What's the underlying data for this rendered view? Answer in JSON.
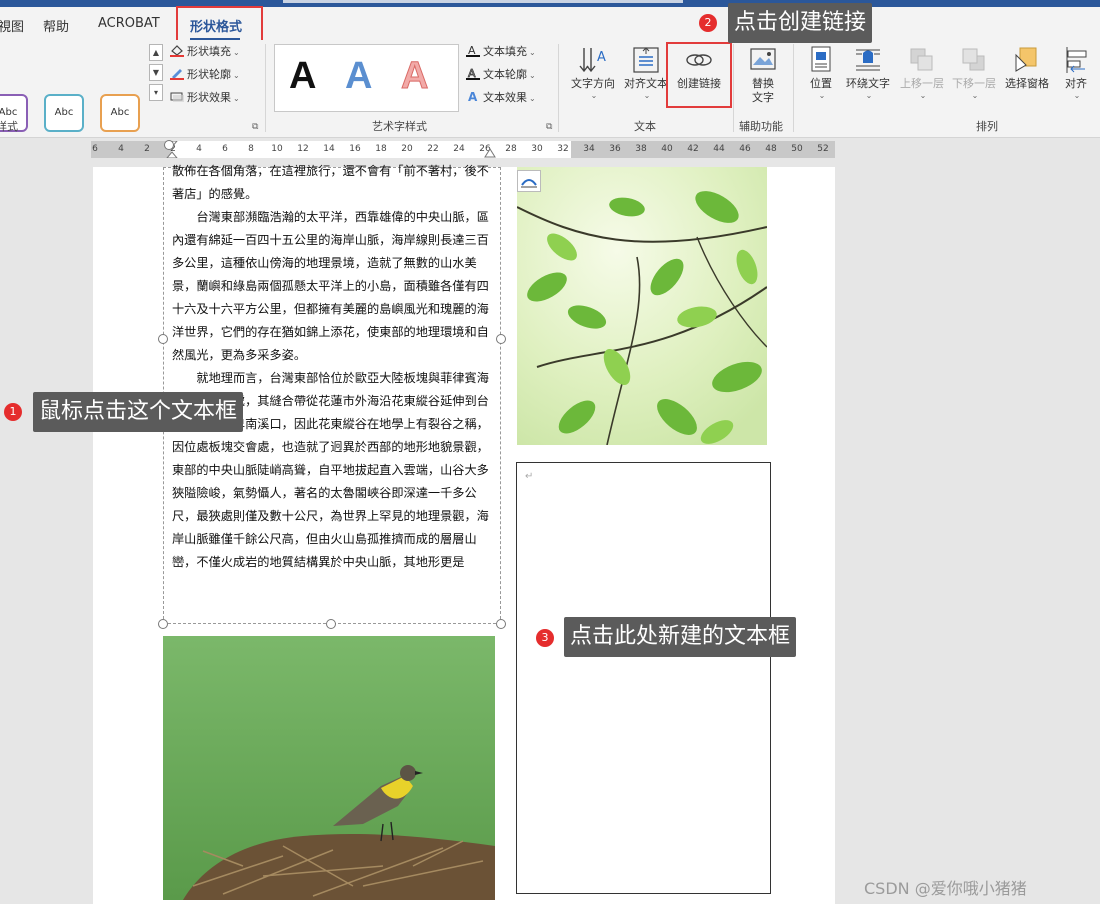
{
  "tabs": [
    {
      "label": "視图"
    },
    {
      "label": "帮助"
    },
    {
      "label": "ACROBAT"
    },
    {
      "label": "形状格式"
    }
  ],
  "ribbon": {
    "shape_styles": {
      "sample_label": "Abc",
      "fill_label": "形状填充",
      "outline_label": "形状轮廓",
      "effect_label": "形状效果",
      "group_label": "样式"
    },
    "wordart": {
      "letter": "A",
      "text_fill_label": "文本填充",
      "text_outline_label": "文本轮廓",
      "text_effect_label": "文本效果",
      "group_label": "艺术字样式"
    },
    "text_group": {
      "direction_label": "文字方向",
      "align_label": "对齐文本",
      "create_link_label": "创建链接",
      "group_label": "文本"
    },
    "accessibility": {
      "alt_text_line1": "替换",
      "alt_text_line2": "文字",
      "group_label": "辅助功能"
    },
    "arrange": {
      "position_label": "位置",
      "wrap_label": "环绕文字",
      "bring_forward_label": "上移一层",
      "send_backward_label": "下移一层",
      "selection_pane_label": "选择窗格",
      "align_label": "对齐",
      "group_label": "排列"
    }
  },
  "ruler": {
    "ticks": [
      "6",
      "4",
      "2",
      "2",
      "4",
      "6",
      "8",
      "10",
      "12",
      "14",
      "16",
      "18",
      "20",
      "22",
      "24",
      "26",
      "28",
      "30",
      "32",
      "34",
      "36",
      "38",
      "40",
      "42",
      "44",
      "46",
      "48",
      "50",
      "52"
    ]
  },
  "document": {
    "paragraphs": [
      "散佈在各個角落，在這裡旅行，還不會有「前不著村，後不著店」的感覺。",
      "",
      "台灣東部瀕臨浩瀚的太平洋，西靠雄偉的中央山脈，區內還有綿延一百四十五公里的海岸山脈，海岸線則長達三百多公里，這種依山傍海的地理景境，造就了無數的山水美景，蘭嶼和綠島兩個孤懸太平洋上的小島，面積雖各僅有四十六及十六平方公里，但都擁有美麗的島嶼風光和瑰麗的海洋世界，它們的存在猶如錦上添花，使東部的地理環境和自然風光，更為多采多姿。",
      "",
      "就地理而言，台灣東部恰位於歐亞大陸板塊與菲律賓海板塊的交會處，其縫合帶從花蓮市外海沿花東縱谷延伸到台東市北方的卑南溪口，因此花東縱谷在地學上有裂谷之稱，因位處板塊交會處，也造就了迥異於西部的地形地貌景觀，東部的中央山脈陡峭高聳，自平地拔起直入雲端，山谷大多狹隘險峻，氣勢懾人，著名的太魯閣峽谷即深達一千多公尺，最狹處則僅及數十公尺，為世界上罕見的地理景觀，海岸山脈雖僅千餘公尺高，但由火山島孤推擠而成的層層山巒，不僅火成岩的地質結構異於中央山脈，其地形更是"
    ]
  },
  "callouts": {
    "c1": {
      "number": "1",
      "text": "鼠标点击这个文本框"
    },
    "c2": {
      "number": "2",
      "text": "点击创建链接"
    },
    "c3": {
      "number": "3",
      "text": "点击此处新建的文本框"
    }
  },
  "watermark": "CSDN @爱你哦小猪猪",
  "colors": {
    "accent": "#2b579a",
    "highlight": "#e23b3b",
    "callout_bg": "#5b5b5b",
    "badge": "#e52d2d"
  }
}
